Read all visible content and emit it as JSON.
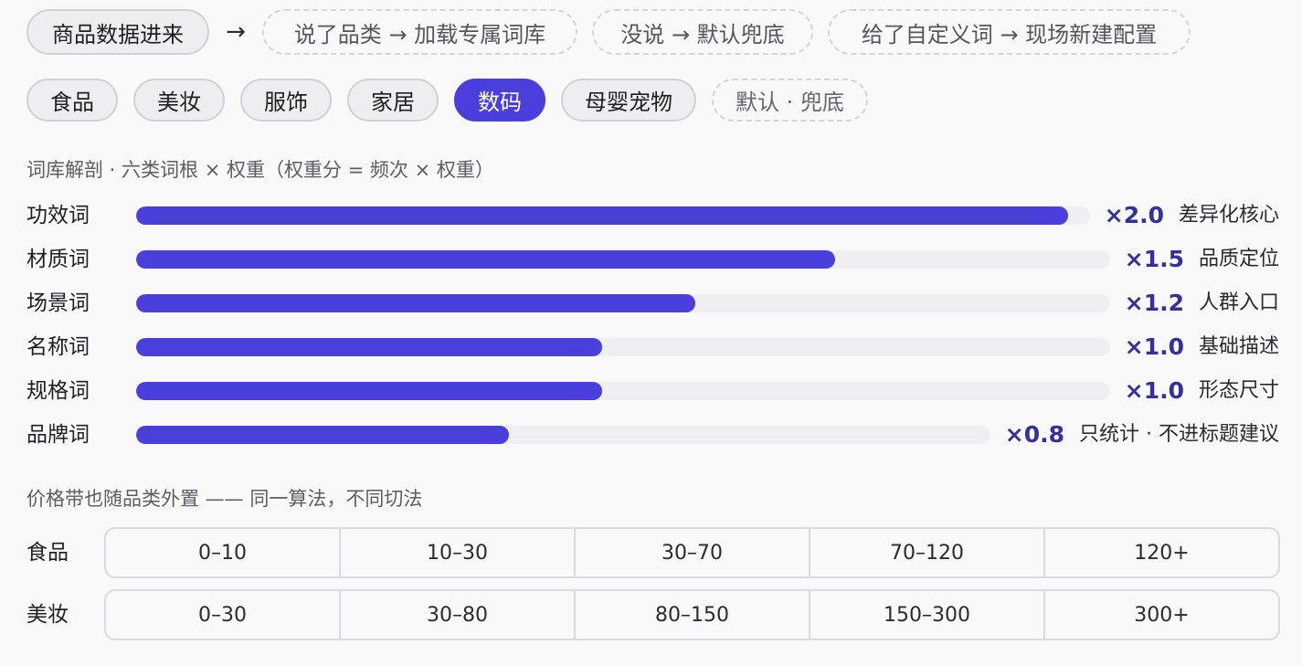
{
  "flow": {
    "start": "商品数据进来",
    "arrow": "→",
    "steps": [
      "说了品类 → 加载专属词库",
      "没说 → 默认兜底",
      "给了自定义词 → 现场新建配置"
    ]
  },
  "categories": [
    {
      "label": "食品",
      "state": "normal"
    },
    {
      "label": "美妆",
      "state": "normal"
    },
    {
      "label": "服饰",
      "state": "normal"
    },
    {
      "label": "家居",
      "state": "normal"
    },
    {
      "label": "数码",
      "state": "active"
    },
    {
      "label": "母婴宠物",
      "state": "normal"
    },
    {
      "label": "默认 · 兜底",
      "state": "muted"
    }
  ],
  "lexicon": {
    "title": "词库解剖 · 六类词根 × 权重（权重分 = 频次 × 权重）",
    "rows": [
      {
        "label": "功效词",
        "value": 2.0,
        "multiplier": "×2.0",
        "note": "差异化核心"
      },
      {
        "label": "材质词",
        "value": 1.5,
        "multiplier": "×1.5",
        "note": "品质定位"
      },
      {
        "label": "场景词",
        "value": 1.2,
        "multiplier": "×1.2",
        "note": "人群入口"
      },
      {
        "label": "名称词",
        "value": 1.0,
        "multiplier": "×1.0",
        "note": "基础描述"
      },
      {
        "label": "规格词",
        "value": 1.0,
        "multiplier": "×1.0",
        "note": "形态尺寸"
      },
      {
        "label": "品牌词",
        "value": 0.8,
        "multiplier": "×0.8",
        "note": "只统计 · 不进标题建议"
      }
    ]
  },
  "price": {
    "title": "价格带也随品类外置 —— 同一算法，不同切法",
    "rows": [
      {
        "label": "食品",
        "bands": [
          "0–10",
          "10–30",
          "30–70",
          "70–120",
          "120+"
        ]
      },
      {
        "label": "美妆",
        "bands": [
          "0–30",
          "30–80",
          "80–150",
          "150–300",
          "300+"
        ]
      }
    ]
  },
  "colors": {
    "accent": "#4a3fdc",
    "multiplier_text": "#34309c",
    "track": "#efeff2"
  }
}
